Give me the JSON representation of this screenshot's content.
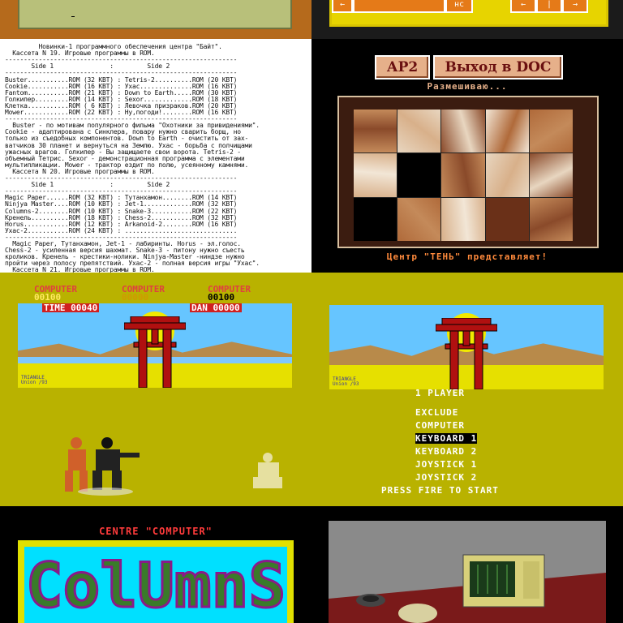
{
  "toolbar": {
    "buttons": [
      "←",
      "",
      "нс",
      "←",
      "|",
      "→"
    ]
  },
  "listing": {
    "lines": [
      "         Новинки-1 программного обеспечения центра \"Байт\".",
      "  Кассета N 19. Игровые программы в ROM.",
      "--------------------------------------------------------------",
      "       Side 1               :         Side 2",
      "--------------------------------------------------------------",
      "Buster...........ROM (32 KBT) : Tetris-2..........ROM (20 KBT)",
      "Cookie...........ROM (16 KBT) : Ухас..............ROM (16 KBT)",
      "Fantom...........ROM (21 KBT) : Down to Earth.....ROM (30 KBT)",
      "Голкипер.........ROM (14 KBT) : Sexor.............ROM (18 KBT)",
      "Клетка...........ROM ( 6 KBT) : Левочка призраков.ROM (20 KBT)",
      "Mower............ROM (22 KBT) : Ну,погоди!........ROM (16 KBT)",
      "--------------------------------------------------------------",
      "  Buster - по мотивам популярного фильма \"Охотники за привидениями\".",
      "Cookie - адаптирована с Синклера, повару нужно сварить борщ, но",
      "только из съедобных компонентов. Down to Earth - очистить от зах-",
      "ватчиков 30 планет и вернуться на Землю. Ухас - борьба с полчищами",
      "ужасных врагов. Голкипер - Вы защищаете свои ворота. Tetris-2 -",
      "объемный Тетрис. Sexor - демонстрационная программа с элементами",
      "мультипликации. Mower - трактор ездит по полю, усеянному камнями.",
      "  Кассета N 20. Игровые программы в ROM.",
      "--------------------------------------------------------------",
      "       Side 1               :         Side 2",
      "--------------------------------------------------------------",
      "Magic Paper......ROM (32 KBT) : Тутанхамон........ROM (14 KBT)",
      "Ninjya Master....ROM (10 KBT) : Jet-1.............ROM (32 KBT)",
      "Columns-2........ROM (10 KBT) : Snake-3...........ROM (22 KBT)",
      "Кренель..........ROM (18 KBT) : Chess-2...........ROM (32 KBT)",
      "Horus............ROM (12 KBT) : Arkanoid-2........ROM (16 KBT)",
      "Ухас-2...........ROM (24 KBT) : ..............................",
      "--------------------------------------------------------------",
      "  Magic Paper, Тутанхамон, Jet-1 - лабиринты. Horus - эл.голос.",
      "Chess-2 - усиленная версия шахмат. Snake-3 - питону нужно съесть",
      "кроликов. Кренель - крестики-нолики. Ninjya-Master -ниндзе нужно",
      "пройти через полосу препятствий. Ухас-2 - полная версия игры \"Ухас\".",
      "  Кассета N 21. Игровые программы в ROM."
    ]
  },
  "puzzle": {
    "btn_ar2": "АР2",
    "btn_exit": "Выход в DOC",
    "status": "Размешиваю...",
    "footer": "Центр \"ТЕНЬ\" представляет!"
  },
  "karate1": {
    "players": [
      "COMPUTER",
      "COMPUTER",
      "COMPUTER"
    ],
    "scores": [
      "00100",
      "00000",
      "00100"
    ],
    "time_label": "TIME 00040",
    "dan_label": "DAN 00000",
    "logo": "TRIANGLE",
    "logo_sub": "Union /93"
  },
  "karate2": {
    "logo": "TRIANGLE",
    "logo_sub": "Union /93",
    "menu": [
      "1 PLAYER",
      "EXCLUDE",
      "COMPUTER",
      "KEYBOARD 1",
      "KEYBOARD 2",
      "JOYSTICK 1",
      "JOYSTICK 2"
    ],
    "selected": "KEYBOARD 1",
    "prompt": "PRESS FIRE TO START"
  },
  "columns": {
    "title": "CENTRE  \"COMPUTER\"",
    "logo": "ColUmnS"
  },
  "colors": {
    "olive_bg": "#b9b200",
    "accent_orange": "#e57a18",
    "toolbar_yellow": "#e7d400"
  }
}
